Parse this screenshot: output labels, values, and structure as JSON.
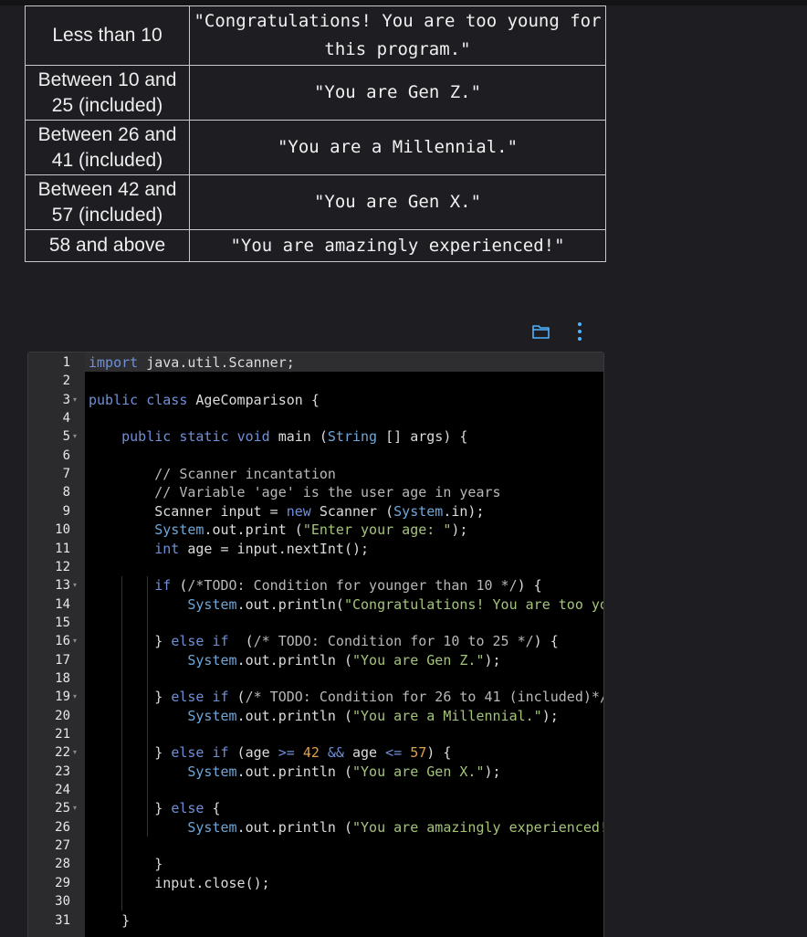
{
  "table": {
    "rows": [
      {
        "range": "Less than 10",
        "message": "\"Congratulations! You are too young for this program.\""
      },
      {
        "range": "Between 10 and 25 (included)",
        "message": "\"You are Gen Z.\""
      },
      {
        "range": "Between 26 and 41 (included)",
        "message": "\"You are a Millennial.\""
      },
      {
        "range": "Between 42 and 57 (included)",
        "message": "\"You are Gen X.\""
      },
      {
        "range": "58 and above",
        "message": "\"You are amazingly experienced!\""
      }
    ]
  },
  "toolbar": {
    "folder_icon": "folder-icon",
    "menu_icon": "more-vertical-icon"
  },
  "editor": {
    "line_numbers": [
      "1",
      "2",
      "3",
      "4",
      "5",
      "6",
      "7",
      "8",
      "9",
      "10",
      "11",
      "12",
      "13",
      "14",
      "15",
      "16",
      "17",
      "18",
      "19",
      "20",
      "21",
      "22",
      "23",
      "24",
      "25",
      "26",
      "27",
      "28",
      "29",
      "30",
      "31"
    ],
    "fold_lines": [
      3,
      5,
      13,
      16,
      19,
      22,
      25
    ],
    "colors": {
      "background": "#000000",
      "gutter": "#2b2b2d",
      "keyword": "#6f8fd8",
      "string": "#a4c47a",
      "number": "#e0a24e"
    },
    "lines": [
      [
        {
          "t": "import",
          "c": "kw"
        },
        {
          "t": " java.util.Scanner;",
          "c": ""
        }
      ],
      [],
      [
        {
          "t": "public",
          "c": "kw"
        },
        {
          "t": " ",
          "c": ""
        },
        {
          "t": "class",
          "c": "kw"
        },
        {
          "t": " AgeComparison {",
          "c": ""
        }
      ],
      [],
      [
        {
          "t": "    ",
          "c": ""
        },
        {
          "t": "public",
          "c": "kw"
        },
        {
          "t": " ",
          "c": ""
        },
        {
          "t": "static",
          "c": "kw"
        },
        {
          "t": " ",
          "c": ""
        },
        {
          "t": "void",
          "c": "kw"
        },
        {
          "t": " main (",
          "c": ""
        },
        {
          "t": "String",
          "c": "typ"
        },
        {
          "t": " [] args) {",
          "c": ""
        }
      ],
      [],
      [
        {
          "t": "        // Scanner incantation",
          "c": "cmt"
        }
      ],
      [
        {
          "t": "        // Variable 'age' is the user age in years",
          "c": "cmt"
        }
      ],
      [
        {
          "t": "        Scanner input = ",
          "c": ""
        },
        {
          "t": "new",
          "c": "kw"
        },
        {
          "t": " Scanner (",
          "c": ""
        },
        {
          "t": "System",
          "c": "typ"
        },
        {
          "t": ".in);",
          "c": ""
        }
      ],
      [
        {
          "t": "        ",
          "c": ""
        },
        {
          "t": "System",
          "c": "typ"
        },
        {
          "t": ".out.print (",
          "c": ""
        },
        {
          "t": "\"Enter your age: \"",
          "c": "str"
        },
        {
          "t": ");",
          "c": ""
        }
      ],
      [
        {
          "t": "        ",
          "c": ""
        },
        {
          "t": "int",
          "c": "kw"
        },
        {
          "t": " age = input.nextInt();",
          "c": ""
        }
      ],
      [],
      [
        {
          "t": "        ",
          "c": ""
        },
        {
          "t": "if",
          "c": "kw"
        },
        {
          "t": " (",
          "c": ""
        },
        {
          "t": "/*TODO: Condition for younger than 10 */",
          "c": "cmt"
        },
        {
          "t": ") {",
          "c": ""
        }
      ],
      [
        {
          "t": "            ",
          "c": ""
        },
        {
          "t": "System",
          "c": "typ"
        },
        {
          "t": ".out.println(",
          "c": ""
        },
        {
          "t": "\"Congratulations! You are too young for this program.\"",
          "c": "str"
        },
        {
          "t": ");",
          "c": ""
        }
      ],
      [],
      [
        {
          "t": "        } ",
          "c": ""
        },
        {
          "t": "else if",
          "c": "kw"
        },
        {
          "t": "  (",
          "c": ""
        },
        {
          "t": "/* TODO: Condition for 10 to 25 */",
          "c": "cmt"
        },
        {
          "t": ") {",
          "c": ""
        }
      ],
      [
        {
          "t": "            ",
          "c": ""
        },
        {
          "t": "System",
          "c": "typ"
        },
        {
          "t": ".out.println (",
          "c": ""
        },
        {
          "t": "\"You are Gen Z.\"",
          "c": "str"
        },
        {
          "t": ");",
          "c": ""
        }
      ],
      [],
      [
        {
          "t": "        } ",
          "c": ""
        },
        {
          "t": "else if",
          "c": "kw"
        },
        {
          "t": " (",
          "c": ""
        },
        {
          "t": "/* TODO: Condition for 26 to 41 (included)*/",
          "c": "cmt"
        },
        {
          "t": ") {",
          "c": ""
        }
      ],
      [
        {
          "t": "            ",
          "c": ""
        },
        {
          "t": "System",
          "c": "typ"
        },
        {
          "t": ".out.println (",
          "c": ""
        },
        {
          "t": "\"You are a Millennial.\"",
          "c": "str"
        },
        {
          "t": ");",
          "c": ""
        }
      ],
      [],
      [
        {
          "t": "        } ",
          "c": ""
        },
        {
          "t": "else if",
          "c": "kw"
        },
        {
          "t": " (age ",
          "c": ""
        },
        {
          "t": ">=",
          "c": "kw"
        },
        {
          "t": " ",
          "c": ""
        },
        {
          "t": "42",
          "c": "num"
        },
        {
          "t": " ",
          "c": ""
        },
        {
          "t": "&&",
          "c": "kw"
        },
        {
          "t": " age ",
          "c": ""
        },
        {
          "t": "<=",
          "c": "kw"
        },
        {
          "t": " ",
          "c": ""
        },
        {
          "t": "57",
          "c": "num"
        },
        {
          "t": ") {",
          "c": ""
        }
      ],
      [
        {
          "t": "            ",
          "c": ""
        },
        {
          "t": "System",
          "c": "typ"
        },
        {
          "t": ".out.println (",
          "c": ""
        },
        {
          "t": "\"You are Gen X.\"",
          "c": "str"
        },
        {
          "t": ");",
          "c": ""
        }
      ],
      [],
      [
        {
          "t": "        } ",
          "c": ""
        },
        {
          "t": "else",
          "c": "kw"
        },
        {
          "t": " {",
          "c": ""
        }
      ],
      [
        {
          "t": "            ",
          "c": ""
        },
        {
          "t": "System",
          "c": "typ"
        },
        {
          "t": ".out.println (",
          "c": ""
        },
        {
          "t": "\"You are amazingly experienced!\"",
          "c": "str"
        },
        {
          "t": ");",
          "c": ""
        }
      ],
      [],
      [
        {
          "t": "        }",
          "c": ""
        }
      ],
      [
        {
          "t": "        input.close();",
          "c": ""
        }
      ],
      [],
      [
        {
          "t": "    }",
          "c": ""
        }
      ]
    ]
  }
}
